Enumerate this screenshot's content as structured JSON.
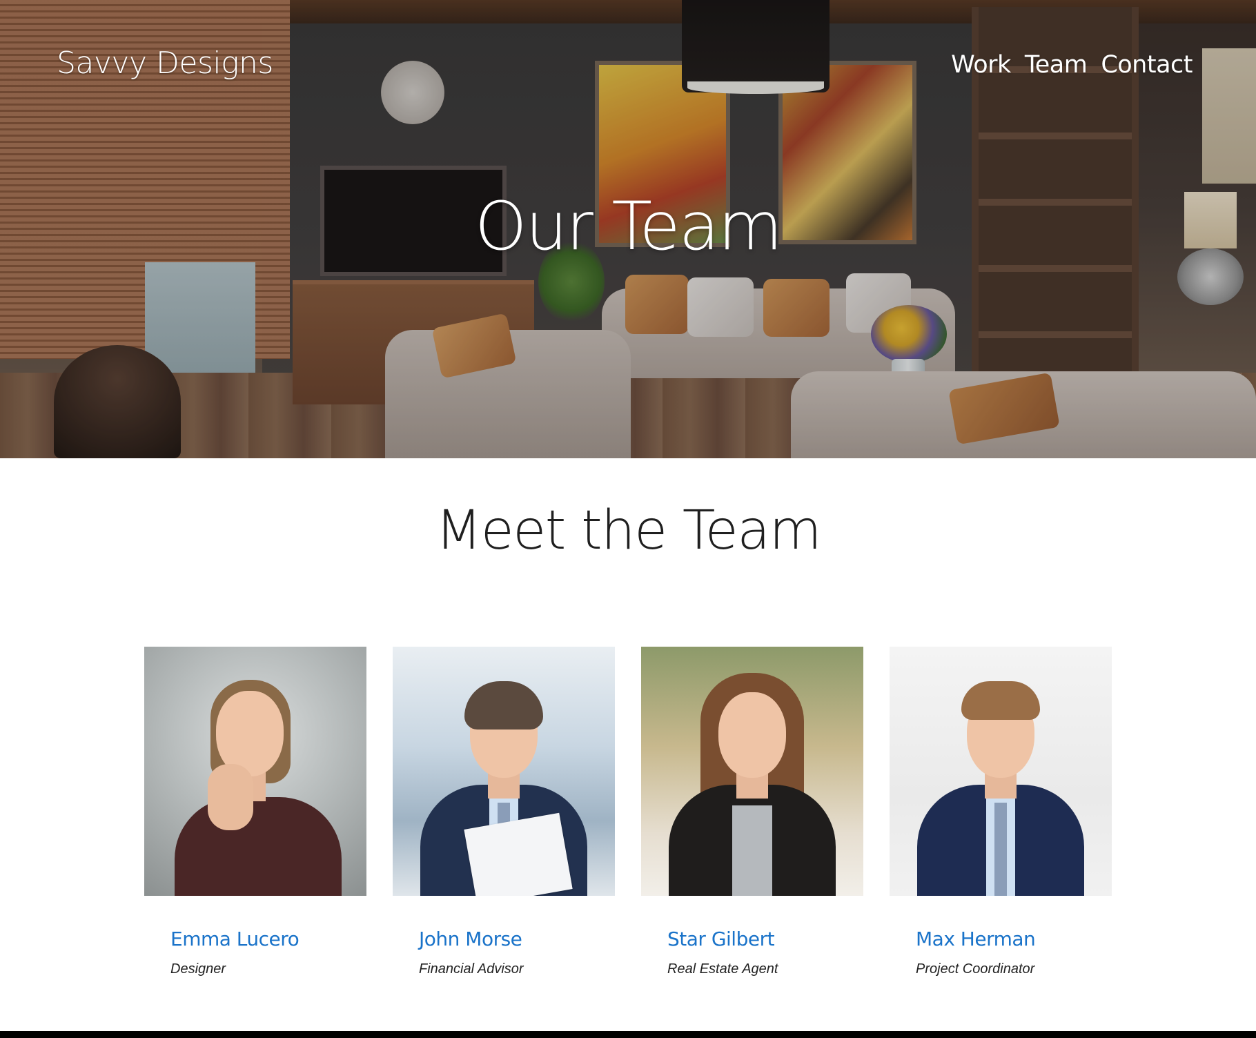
{
  "header": {
    "brand": "Savvy Designs",
    "nav": [
      "Work",
      "Team",
      "Contact"
    ]
  },
  "hero": {
    "title": "Our Team",
    "image": "living-room-interior-photo"
  },
  "team": {
    "heading": "Meet the Team",
    "members": [
      {
        "name": "Emma Lucero",
        "role": "Designer",
        "photo": "woman-hand-on-chin-portrait"
      },
      {
        "name": "John Morse",
        "role": "Financial Advisor",
        "photo": "man-in-suit-holding-paper-portrait"
      },
      {
        "name": "Star Gilbert",
        "role": "Real Estate Agent",
        "photo": "smiling-woman-leather-jacket-portrait"
      },
      {
        "name": "Max Herman",
        "role": "Project Coordinator",
        "photo": "smiling-man-in-suit-portrait"
      }
    ]
  },
  "colors": {
    "link": "#1a73c9",
    "heading": "#1f1f1f",
    "footer": "#000000"
  }
}
